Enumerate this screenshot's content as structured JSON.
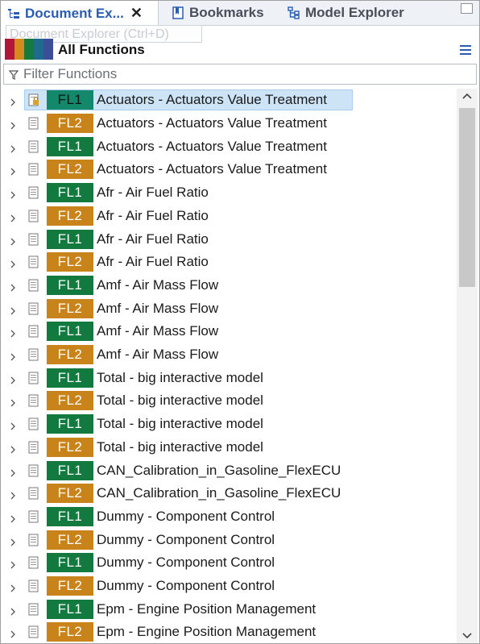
{
  "tabs": [
    {
      "label": "Document Ex...",
      "icon": "tree-icon",
      "active": true,
      "closable": true
    },
    {
      "label": "Bookmarks",
      "icon": "bookmark-icon",
      "active": false
    },
    {
      "label": "Model Explorer",
      "icon": "hierarchy-icon",
      "active": false
    }
  ],
  "tooltip": "Document Explorer (Ctrl+D)",
  "header": {
    "title": "All Functions",
    "color_strip": [
      "#b3163b",
      "#d38b1f",
      "#157a3c",
      "#1f6a8e",
      "#3a4f96"
    ],
    "view_icon": "list-view-icon"
  },
  "filter": {
    "placeholder": "Filter Functions",
    "value": ""
  },
  "colors": {
    "fl1": "#127a3e",
    "fl2": "#c8841a",
    "selection": "#cde3f6"
  },
  "rows": [
    {
      "badge": "FL1",
      "label": "Actuators - Actuators Value Treatment",
      "selected": true
    },
    {
      "badge": "FL2",
      "label": "Actuators - Actuators Value Treatment"
    },
    {
      "badge": "FL1",
      "label": "Actuators - Actuators Value Treatment"
    },
    {
      "badge": "FL2",
      "label": "Actuators - Actuators Value Treatment"
    },
    {
      "badge": "FL1",
      "label": "Afr - Air Fuel Ratio"
    },
    {
      "badge": "FL2",
      "label": "Afr - Air Fuel Ratio"
    },
    {
      "badge": "FL1",
      "label": "Afr - Air Fuel Ratio"
    },
    {
      "badge": "FL2",
      "label": "Afr - Air Fuel Ratio"
    },
    {
      "badge": "FL1",
      "label": "Amf - Air Mass Flow"
    },
    {
      "badge": "FL2",
      "label": "Amf - Air Mass Flow"
    },
    {
      "badge": "FL1",
      "label": "Amf - Air Mass Flow"
    },
    {
      "badge": "FL2",
      "label": "Amf - Air Mass Flow"
    },
    {
      "badge": "FL1",
      "label": "Total - big interactive model"
    },
    {
      "badge": "FL2",
      "label": "Total - big interactive model"
    },
    {
      "badge": "FL1",
      "label": "Total - big interactive model"
    },
    {
      "badge": "FL2",
      "label": "Total - big interactive model"
    },
    {
      "badge": "FL1",
      "label": "CAN_Calibration_in_Gasoline_FlexECU"
    },
    {
      "badge": "FL2",
      "label": "CAN_Calibration_in_Gasoline_FlexECU"
    },
    {
      "badge": "FL1",
      "label": "Dummy - Component Control"
    },
    {
      "badge": "FL2",
      "label": "Dummy - Component Control"
    },
    {
      "badge": "FL1",
      "label": "Dummy - Component Control"
    },
    {
      "badge": "FL2",
      "label": "Dummy - Component Control"
    },
    {
      "badge": "FL1",
      "label": "Epm - Engine Position Management"
    },
    {
      "badge": "FL2",
      "label": "Epm - Engine Position Management"
    }
  ]
}
